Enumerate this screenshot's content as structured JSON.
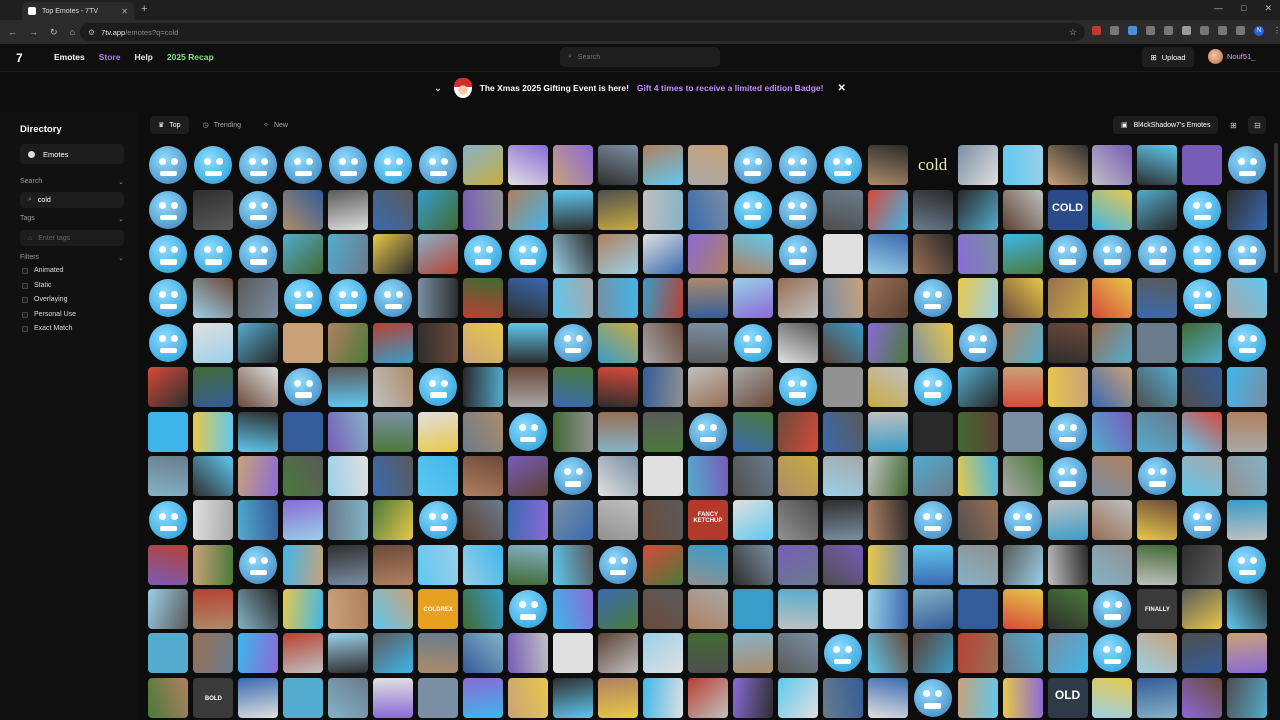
{
  "browser": {
    "tab_title": "Top Emotes - 7TV",
    "new_tab": "+",
    "url_host": "7tv.app",
    "url_path": "/emotes?q=cold",
    "window_controls": [
      "—",
      "□",
      "✕"
    ]
  },
  "header": {
    "logo": "7",
    "nav": [
      {
        "label": "Emotes"
      },
      {
        "label": "Store"
      },
      {
        "label": "Help"
      },
      {
        "label": "2025 Recap"
      }
    ],
    "search_placeholder": "Search",
    "upload_label": "Upload",
    "username": "Nouf51_"
  },
  "banner": {
    "text": "The Xmas 2025 Gifting Event is here!",
    "highlight": "Gift 4 times to receive a limited edition Badge!"
  },
  "sidebar": {
    "title": "Directory",
    "emotes_button": "Emotes",
    "search_label": "Search",
    "search_value": "cold",
    "tags_label": "Tags",
    "tags_placeholder": "Enter tags",
    "filters_label": "Filters",
    "filters": [
      "Animated",
      "Static",
      "Overlaying",
      "Personal Use",
      "Exact Match"
    ]
  },
  "toolbar": {
    "tabs": [
      "Top",
      "Trending",
      "New"
    ],
    "emote_set_label": "Bl4ckShadow7's Emotes"
  },
  "grid": {
    "text_emotes": {
      "cold": "cold",
      "fancy": "FANCY KETCHUP",
      "cold_block": "COLD",
      "finally": "FINALLY",
      "bold": "BOLD",
      "old": "OLD",
      "coldrex": "COLDREX"
    }
  },
  "colors": {
    "accent_purple": "#b17cf5",
    "recap_green": "#86e07a",
    "cold_blue": "#3fb6ea"
  }
}
